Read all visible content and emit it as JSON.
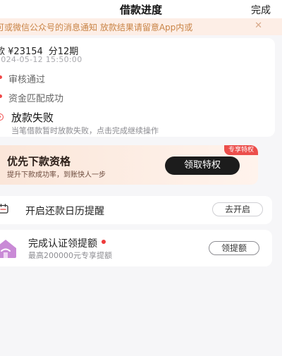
{
  "header": {
    "title": "借款进度",
    "done_label": "完成"
  },
  "notice": {
    "text": "可或微信公众号的消息通知    放款结果请留意App内或",
    "close_icon": "close-icon"
  },
  "loan": {
    "amount_text": "款 ¥23154",
    "term_text": "分12期",
    "date_text": "2024-05-12 15:50:00"
  },
  "steps": [
    {
      "label": "审核通过",
      "status": "done"
    },
    {
      "label": "资金匹配成功",
      "status": "done"
    },
    {
      "label": "放款失败",
      "status": "failed"
    }
  ],
  "step_note": "当笔借款暂时放款失败，点击完成继续操作",
  "promo": {
    "tag": "专享特权",
    "title": "优先下款资格",
    "subtitle": "提升下款成功率，到账快人一步",
    "button": "领取特权"
  },
  "calendar": {
    "label": "开启还款日历提醒",
    "button": "去开启",
    "icon": "calendar-icon"
  },
  "cert": {
    "title": "完成认证领提额",
    "subtitle": "最高200000元专享提额",
    "button": "领提额",
    "icon": "house-icon"
  },
  "colors": {
    "accent_red": "#ec4e4b",
    "notice_text": "#c98446",
    "notice_bg": "#fdeee6"
  }
}
